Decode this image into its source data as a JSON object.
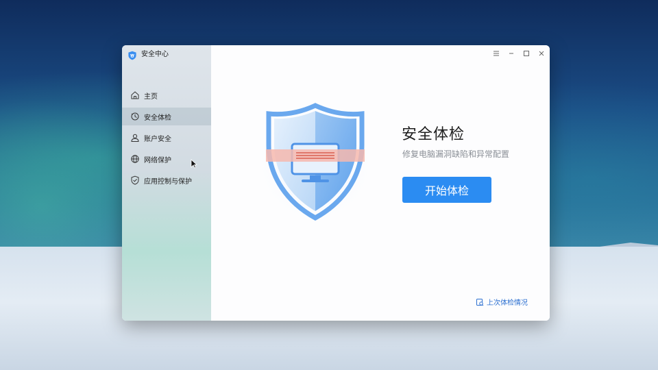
{
  "window": {
    "title": "安全中心",
    "controls": {
      "menu_icon": "menu-icon",
      "minimize_icon": "minimize-icon",
      "maximize_icon": "maximize-icon",
      "close_icon": "close-icon"
    }
  },
  "sidebar": {
    "items": [
      {
        "label": "主页",
        "icon": "home-icon",
        "active": false
      },
      {
        "label": "安全体检",
        "icon": "clock-scan-icon",
        "active": true
      },
      {
        "label": "账户安全",
        "icon": "user-icon",
        "active": false
      },
      {
        "label": "网络保护",
        "icon": "globe-icon",
        "active": false
      },
      {
        "label": "应用控制与保护",
        "icon": "shield-check-icon",
        "active": false
      }
    ]
  },
  "main": {
    "title": "安全体检",
    "subtitle": "修复电脑漏洞缺陷和异常配置",
    "start_button": "开始体检",
    "last_check_link": "上次体检情况"
  },
  "colors": {
    "accent": "#2b8cf2",
    "link": "#2b6fd0",
    "sidebar_active": "#c7d0d8"
  }
}
